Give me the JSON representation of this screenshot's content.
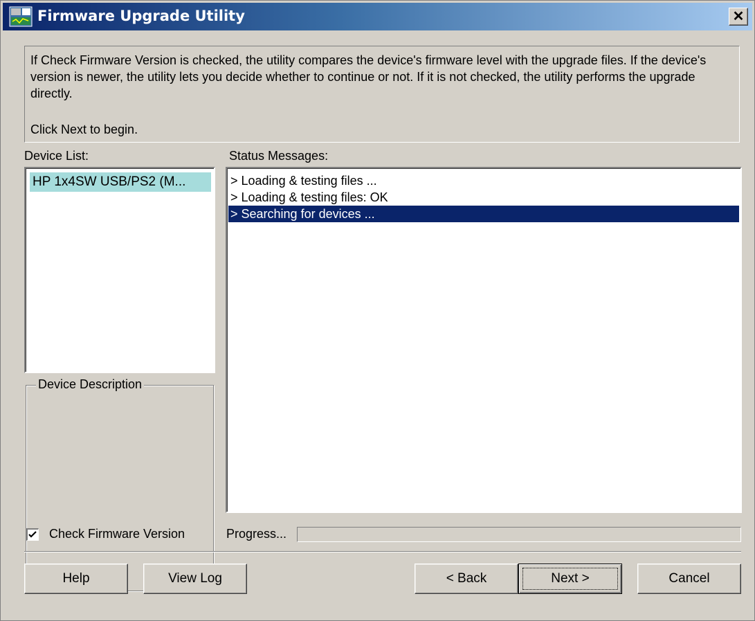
{
  "window": {
    "title": "Firmware Upgrade Utility",
    "close_glyph": "✕",
    "app_icon": "firmware-utility-icon"
  },
  "info": {
    "text": "If Check Firmware Version is checked, the utility compares the device's firmware level with the upgrade files. If the device's version is newer, the utility lets you decide whether to continue or not. If it is not checked, the utility performs the upgrade directly.",
    "hint": "Click Next to begin."
  },
  "device_list": {
    "label": "Device List:",
    "items": [
      "HP 1x4SW USB/PS2 (M..."
    ]
  },
  "status_messages": {
    "label": "Status Messages:",
    "lines": [
      "> Loading & testing files ...",
      "> Loading & testing files: OK",
      "> Searching for devices ..."
    ],
    "selected_index": 2
  },
  "device_description": {
    "label": "Device Description"
  },
  "check_firmware": {
    "label": "Check Firmware Version",
    "checked": true
  },
  "progress": {
    "label": "Progress...",
    "value": 0
  },
  "buttons": {
    "help": "Help",
    "view_log": "View Log",
    "back": "< Back",
    "next": "Next >",
    "cancel": "Cancel"
  },
  "colors": {
    "face": "#d4d0c8",
    "title_start": "#0a246a",
    "title_end": "#a6caf0",
    "selection": "#0a246a",
    "device_highlight": "#a6dcdc"
  }
}
